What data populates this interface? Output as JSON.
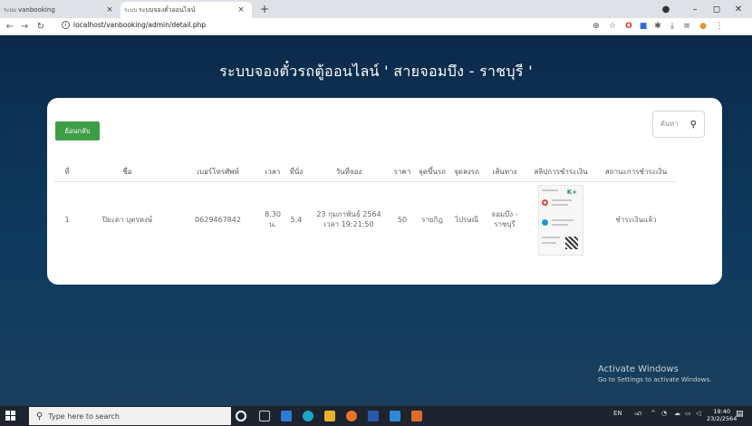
{
  "browser": {
    "tabs": [
      {
        "title": "vanbooking",
        "favicon": "ระบบ",
        "active": false
      },
      {
        "title": "ระบบจองตั๋วออนไลน์",
        "favicon": "ระบบ",
        "active": true
      }
    ],
    "url": "localhost/vanbooking/admin/detail.php"
  },
  "page": {
    "title": "ระบบจองตั๋วรถตู้ออนไลน์ ' สายจอมบึง - ราชบุรี '",
    "back_label": "ย้อนกลับ",
    "search_placeholder": "ค้นหา"
  },
  "table": {
    "headers": [
      "ที่",
      "ชื่อ",
      "เบอร์โทรศัพท์",
      "เวลา",
      "ที่นั่ง",
      "วันที่จอง",
      "ราคา",
      "จุดขึ้นรถ",
      "จุดลงรถ",
      "เส้นทาง",
      "สลิปการชำระเงิน",
      "สถานะการชำระเงิน"
    ],
    "rows": [
      {
        "no": "1",
        "name": "ปิยะดา บุตรหงษ์",
        "phone": "0629467842",
        "time": "8.30 น.",
        "seat": "5,4",
        "booking_date": "23 กุมภาพันธ์ 2564 เวลา 19:21:50",
        "price": "50",
        "pickup": "รายกิฎ",
        "dropoff": "ไปรษณี",
        "route": "จอมบึง - ราชบุรี",
        "status": "ชำระเงินแล้ว"
      }
    ]
  },
  "watermark": {
    "line1": "Activate Windows",
    "line2": "Go to Settings to activate Windows."
  },
  "taskbar": {
    "search_placeholder": "Type here to search",
    "lang": "EN",
    "time": "19:40",
    "date": "23/2/2564"
  },
  "colors": {
    "back_button": "#3e9e46",
    "page_bg": "#0b2a4a"
  }
}
